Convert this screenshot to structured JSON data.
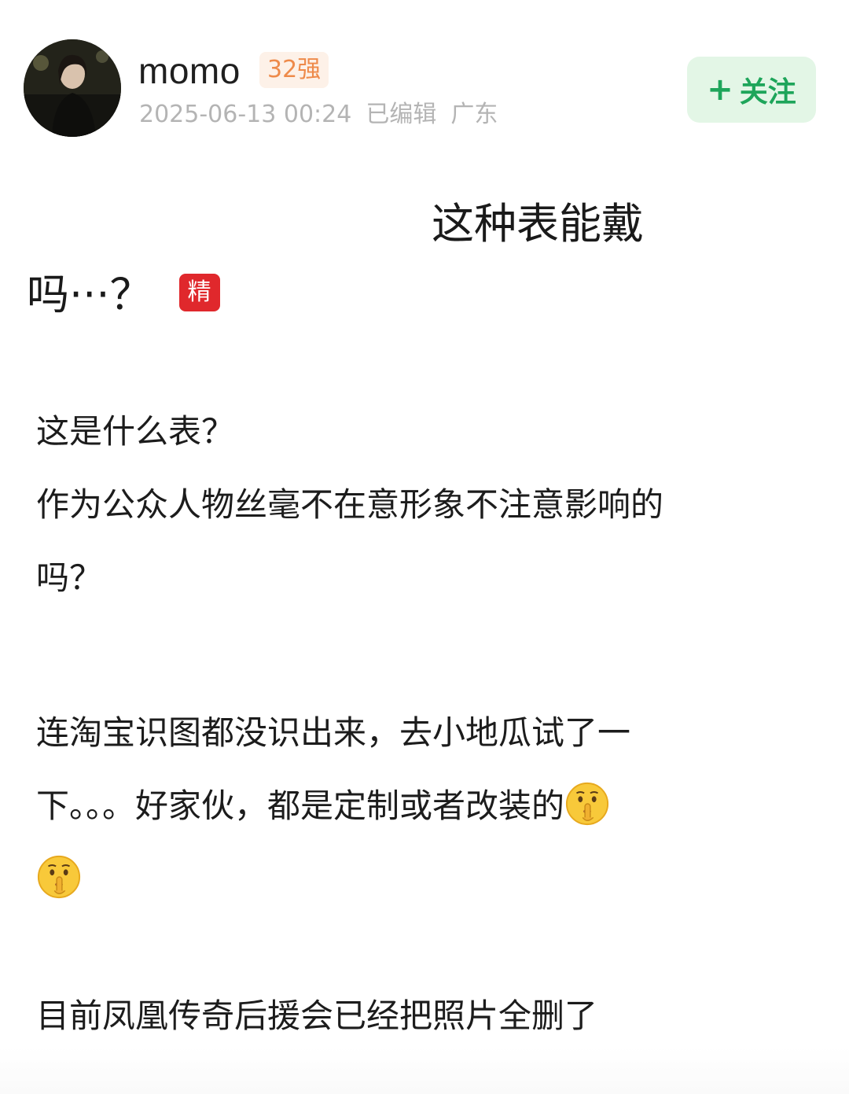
{
  "author": {
    "name": "momo",
    "rank_badge": "32强",
    "timestamp": "2025-06-13 00:24",
    "edited_label": "已编辑",
    "location": "广东",
    "follow_label": "关注",
    "follow_plus": "+"
  },
  "post": {
    "title_line1": "这种表能戴",
    "title_line2": "吗···？",
    "featured_label": "精",
    "paragraph1": [
      "这是什么表？",
      "作为公众人物丝毫不在意形象不注意影响的",
      "吗？"
    ],
    "paragraph2_line1": "连淘宝识图都没识出来，去小地瓜试了一",
    "paragraph2_line2": "下。。。好家伙，都是定制或者改装的",
    "paragraph3": "目前凤凰传奇后援会已经把照片全删了"
  },
  "colors": {
    "follow_bg": "#e3f6e6",
    "follow_text": "#1ea55a",
    "rank_bg": "#fdf1e8",
    "rank_text": "#ee8a4a",
    "featured_bg": "#e0282c",
    "meta_text": "#b4b4b4"
  },
  "icons": {
    "avatar": "user-avatar-photo",
    "emoji": "shushing-face-icon"
  }
}
